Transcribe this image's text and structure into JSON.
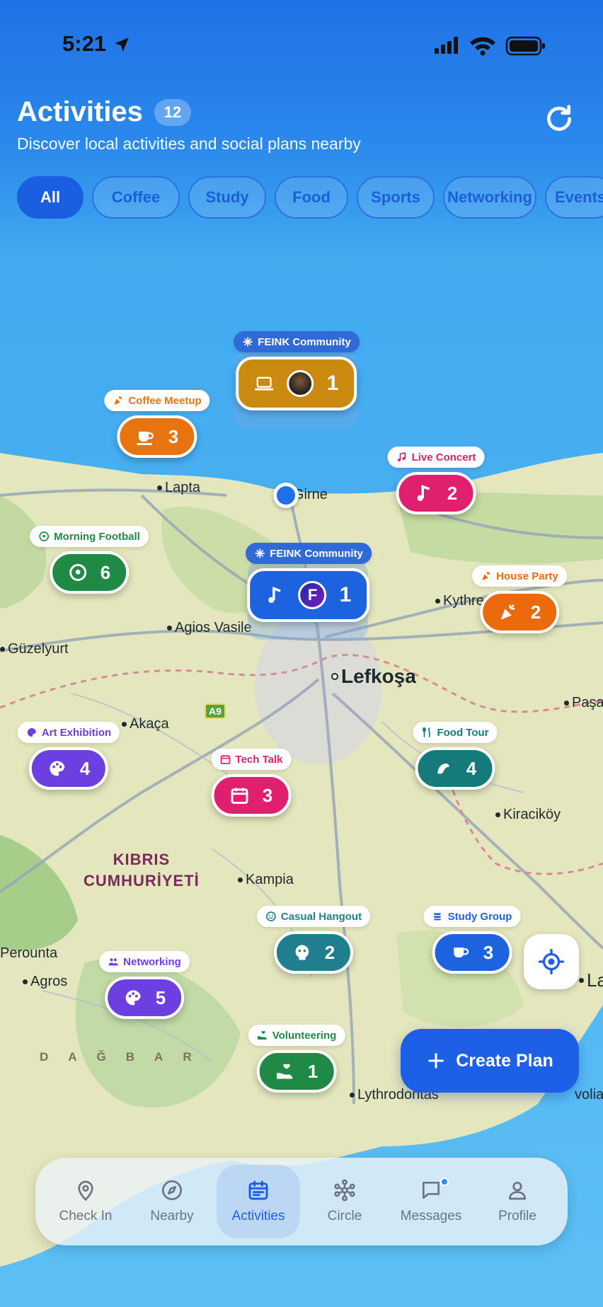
{
  "status_bar": {
    "time": "5:21"
  },
  "header": {
    "title": "Activities",
    "count": "12",
    "subtitle": "Discover local activities and social plans nearby"
  },
  "filters": [
    "All",
    "Coffee",
    "Study",
    "Food",
    "Sports",
    "Networking",
    "Events"
  ],
  "places": {
    "lapta": "Lapta",
    "girne": "Girne",
    "kythrea": "Kythre",
    "agios_vasilios": "Agios Vasile",
    "guzelyurt": "Güzelyurt",
    "lefkosa": "Lefkoşa",
    "pasa": "Paşa",
    "akaca": "Akaça",
    "kiracikoy": "Kiraciköy",
    "kampia": "Kampia",
    "perounta": "Perounta",
    "agros": "Agros",
    "lythrodontas": "Lythrodontas",
    "volia": "volia",
    "la": "La"
  },
  "country_label": {
    "line1": "KIBRIS",
    "line2": "CUMHURİYETİ"
  },
  "mountains": "DAĞBAR",
  "road": "A9",
  "markers": [
    {
      "tag": "FEINK Community",
      "count": "1",
      "icon": "laptop-icon",
      "color": "#c98a0f",
      "tag_color": "#ffffff",
      "tag_bg": "#2f6ad8"
    },
    {
      "tag": "Coffee Meetup",
      "count": "3",
      "icon": "coffee-cup-icon",
      "color": "#e8740f",
      "tag_color": "#e8740f",
      "tag_bg": "#ffffff"
    },
    {
      "tag": "Live Concert",
      "count": "2",
      "icon": "music-note-icon",
      "color": "#e0206e",
      "tag_color": "#e0206e",
      "tag_bg": "#ffffff"
    },
    {
      "tag": "Morning Football",
      "count": "6",
      "icon": "soccer-ball-icon",
      "color": "#1f8a45",
      "tag_color": "#1f8a45",
      "tag_bg": "#ffffff"
    },
    {
      "tag": "FEINK Community",
      "count": "1",
      "icon": "music-note-icon",
      "color": "#1d63e0",
      "tag_color": "#ffffff",
      "tag_bg": "#2f6ad8"
    },
    {
      "tag": "House Party",
      "count": "2",
      "icon": "party-popper-icon",
      "color": "#ea6a0c",
      "tag_color": "#ea6a0c",
      "tag_bg": "#ffffff"
    },
    {
      "tag": "Art Exhibition",
      "count": "4",
      "icon": "palette-icon",
      "color": "#6b3fe0",
      "tag_color": "#6b3fe0",
      "tag_bg": "#ffffff"
    },
    {
      "tag": "Tech Talk",
      "count": "3",
      "icon": "calendar-icon",
      "color": "#e0206e",
      "tag_color": "#e0206e",
      "tag_bg": "#ffffff"
    },
    {
      "tag": "Food Tour",
      "count": "4",
      "icon": "utensils-icon",
      "color": "#157a7a",
      "tag_color": "#157a7a",
      "tag_bg": "#ffffff"
    },
    {
      "tag": "Casual Hangout",
      "count": "2",
      "icon": "smile-icon",
      "color": "#1f7f8f",
      "tag_color": "#1f7f8f",
      "tag_bg": "#ffffff"
    },
    {
      "tag": "Study Group",
      "count": "3",
      "icon": "book-icon",
      "color": "#1d63e0",
      "tag_color": "#1d63e0",
      "tag_bg": "#ffffff"
    },
    {
      "tag": "Networking",
      "count": "5",
      "icon": "people-icon",
      "color": "#6b3fe0",
      "tag_color": "#6b3fe0",
      "tag_bg": "#ffffff"
    },
    {
      "tag": "Volunteering",
      "count": "1",
      "icon": "hand-heart-icon",
      "color": "#1f8a45",
      "tag_color": "#1f8a45",
      "tag_bg": "#ffffff"
    }
  ],
  "create_button": {
    "label": "Create Plan"
  },
  "tabs": [
    {
      "label": "Check In",
      "icon": "map-pin-icon"
    },
    {
      "label": "Nearby",
      "icon": "compass-icon"
    },
    {
      "label": "Activities",
      "icon": "calendar-icon",
      "active": true
    },
    {
      "label": "Circle",
      "icon": "network-icon"
    },
    {
      "label": "Messages",
      "icon": "chat-icon"
    },
    {
      "label": "Profile",
      "icon": "person-icon"
    }
  ],
  "colors": {
    "accent": "#1d5fe6",
    "sea": "#3aa6ee",
    "land": "#e4e6bd"
  }
}
